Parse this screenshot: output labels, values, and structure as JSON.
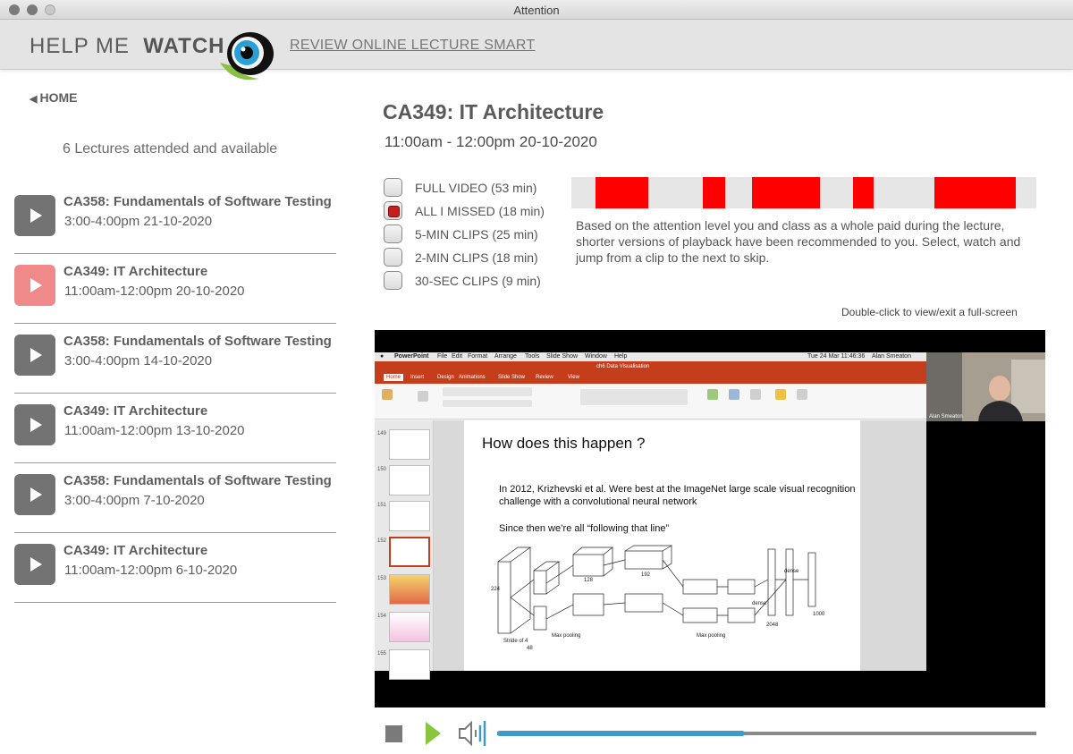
{
  "window": {
    "title": "Attention"
  },
  "header": {
    "logo_light": "HELP ME",
    "logo_bold": "WATCH",
    "tagline": "REVIEW ONLINE LECTURE SMART"
  },
  "sidebar": {
    "home_label": "HOME",
    "lectures_count_text": "6 Lectures attended and available",
    "lectures": [
      {
        "title": "CA358: Fundamentals of Software Testing",
        "time": "3:00-4:00pm 21-10-2020",
        "active": false
      },
      {
        "title": "CA349: IT Architecture",
        "time": "11:00am-12:00pm 20-10-2020",
        "active": true
      },
      {
        "title": "CA358: Fundamentals of Software Testing",
        "time": "3:00-4:00pm 14-10-2020",
        "active": false
      },
      {
        "title": "CA349: IT Architecture",
        "time": "11:00am-12:00pm 13-10-2020",
        "active": false
      },
      {
        "title": "CA358: Fundamentals of Software Testing",
        "time": "3:00-4:00pm 7-10-2020",
        "active": false
      },
      {
        "title": "CA349: IT Architecture",
        "time": "11:00am-12:00pm 6-10-2020",
        "active": false
      }
    ]
  },
  "main": {
    "course_title": "CA349: IT Architecture",
    "course_time": "11:00am - 12:00pm 20-10-2020",
    "options": [
      {
        "label": "FULL VIDEO (53 min)",
        "checked": false
      },
      {
        "label": "ALL I MISSED (18 min)",
        "checked": true
      },
      {
        "label": "5-MIN CLIPS (25 min)",
        "checked": false
      },
      {
        "label": "2-MIN CLIPS (18 min)",
        "checked": false
      },
      {
        "label": "30-SEC CLIPS (9 min)",
        "checked": false
      }
    ],
    "missed_segments": [
      {
        "start": 0.052,
        "end": 0.165
      },
      {
        "start": 0.283,
        "end": 0.331
      },
      {
        "start": 0.388,
        "end": 0.535
      },
      {
        "start": 0.606,
        "end": 0.65
      },
      {
        "start": 0.781,
        "end": 0.956
      }
    ],
    "explanation": "Based on the attention level you and class as a whole paid during the lecture, shorter versions of playback have been recommended to you. Select, watch and jump from a clip to the next to skip.",
    "fullscreen_hint": "Double-click to view/exit a full-screen"
  },
  "video": {
    "menubar_app": "PowerPoint",
    "menubar_items": [
      "File",
      "Edit",
      "Format",
      "Arrange",
      "Tools",
      "Slide Show",
      "Window",
      "Help"
    ],
    "menubar_clock": "Tue 24 Mar  11:46:36",
    "menubar_user": "Alan Smeaton",
    "doc_title": "ch6 Data Visualisation",
    "ribbon_tabs": [
      "Home",
      "Insert",
      "Design",
      "Animations",
      "Slide Show",
      "Review",
      "View"
    ],
    "slide_numbers": [
      "149",
      "150",
      "151",
      "152",
      "153",
      "154",
      "155"
    ],
    "slide_title": "How does this happen ?",
    "slide_p1": "In 2012, Krizhevski et al. Were best at the ImageNet large scale visual recognition challenge with a convolutional neural network",
    "slide_p2": "Since then we’re all “following that line”",
    "webcam_name": "Alan Smeaton",
    "net_labels": {
      "dense": "dense",
      "max_pooling": "Max pooling",
      "stride": "Stride of 4",
      "n224": "224",
      "n48": "48",
      "n128": "128",
      "n192": "192",
      "n2048": "2048",
      "n1000": "1000"
    }
  },
  "controls": {
    "progress_fraction": 0.46,
    "accent_color": "#3f9ac9",
    "play_color": "#8ac53f"
  }
}
